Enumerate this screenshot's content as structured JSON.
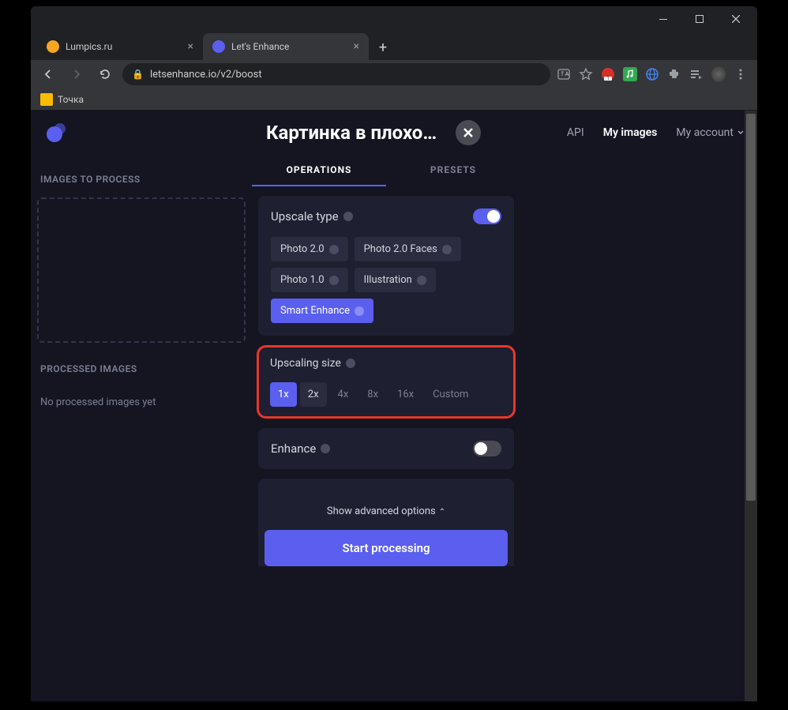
{
  "browser": {
    "tabs": [
      {
        "title": "Lumpics.ru",
        "favicon_color": "#f5a623"
      },
      {
        "title": "Let's Enhance",
        "favicon_color": "#5b5fef"
      }
    ],
    "url": "letsenhance.io/v2/boost",
    "bookmark": "Точка"
  },
  "header": {
    "panel_title": "Картинка в плохо…",
    "nav": {
      "api": "API",
      "my_images": "My images",
      "my_account": "My account"
    }
  },
  "left": {
    "images_label": "IMAGES TO PROCESS",
    "processed_label": "PROCESSED IMAGES",
    "processed_msg": "No processed images yet"
  },
  "tabs": {
    "operations": "OPERATIONS",
    "presets": "PRESETS"
  },
  "upscale_type": {
    "title": "Upscale type",
    "options": [
      "Photo 2.0",
      "Photo 2.0 Faces",
      "Photo 1.0",
      "Illustration",
      "Smart Enhance"
    ],
    "selected": "Smart Enhance"
  },
  "upscaling_size": {
    "title": "Upscaling size",
    "options": [
      "1x",
      "2x",
      "4x",
      "8x",
      "16x",
      "Custom"
    ],
    "selected": "1x",
    "hovered": "2x"
  },
  "enhance": {
    "title": "Enhance"
  },
  "advanced": "Show advanced options",
  "start": "Start processing"
}
